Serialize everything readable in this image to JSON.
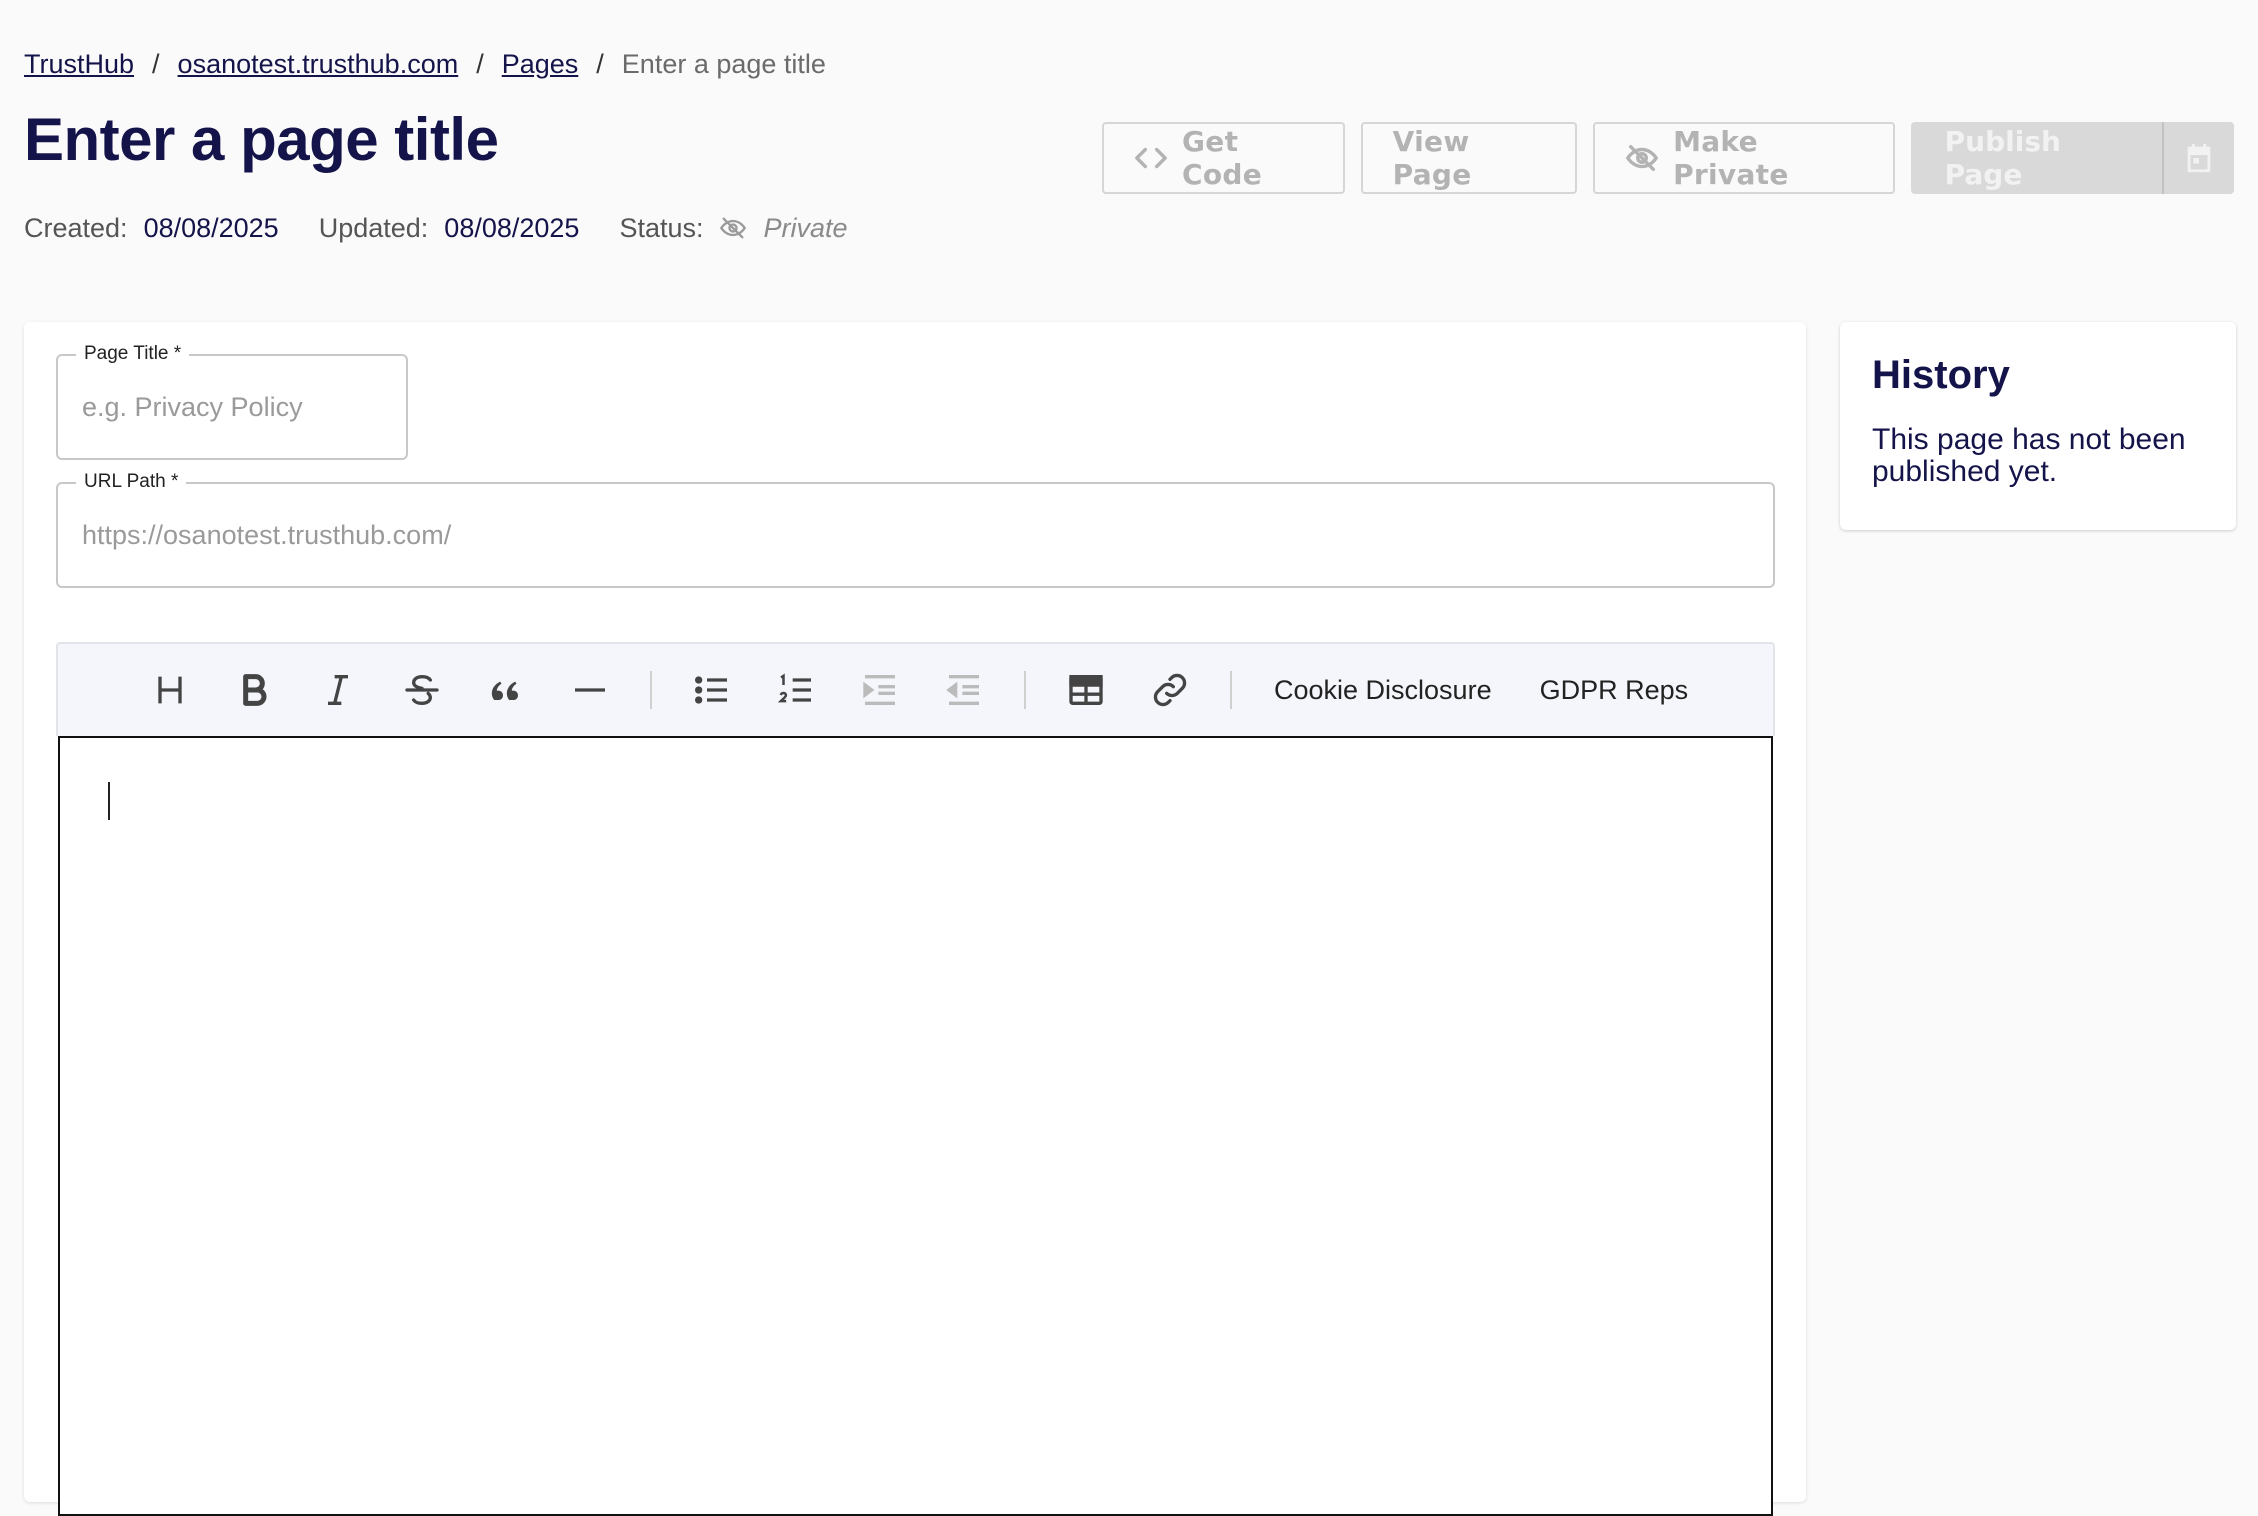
{
  "breadcrumb": {
    "items": [
      "TrustHub",
      "osanotest.trusthub.com",
      "Pages"
    ],
    "separator": "/",
    "current": "Enter a page title"
  },
  "page": {
    "title": "Enter a page title"
  },
  "meta": {
    "created_label": "Created:",
    "created_value": "08/08/2025",
    "updated_label": "Updated:",
    "updated_value": "08/08/2025",
    "status_label": "Status:",
    "status_icon": "eye-off-icon",
    "status_value": "Private"
  },
  "actions": {
    "get_code": "Get Code",
    "view_page": "View Page",
    "make_private": "Make Private",
    "publish_page": "Publish Page",
    "schedule_icon": "calendar-icon"
  },
  "form": {
    "page_title_label": "Page Title *",
    "page_title_placeholder": "e.g. Privacy Policy",
    "page_title_value": "",
    "url_path_label": "URL Path *",
    "url_path_placeholder": "https://osanotest.trusthub.com/",
    "url_path_value": ""
  },
  "toolbar": {
    "buttons": [
      "heading-icon",
      "bold-icon",
      "italic-icon",
      "strikethrough-icon",
      "quote-icon",
      "horizontal-rule-icon",
      "bullet-list-icon",
      "ordered-list-icon",
      "indent-icon",
      "outdent-icon",
      "table-icon",
      "link-icon"
    ],
    "cookie_disclosure": "Cookie Disclosure",
    "gdpr_reps": "GDPR Reps"
  },
  "history": {
    "title": "History",
    "message": "This page has not been published yet."
  },
  "colors": {
    "brand_navy": "#14144a",
    "disabled_gray": "#b3b3b3",
    "publish_disabled_bg": "#d9d9d9"
  }
}
